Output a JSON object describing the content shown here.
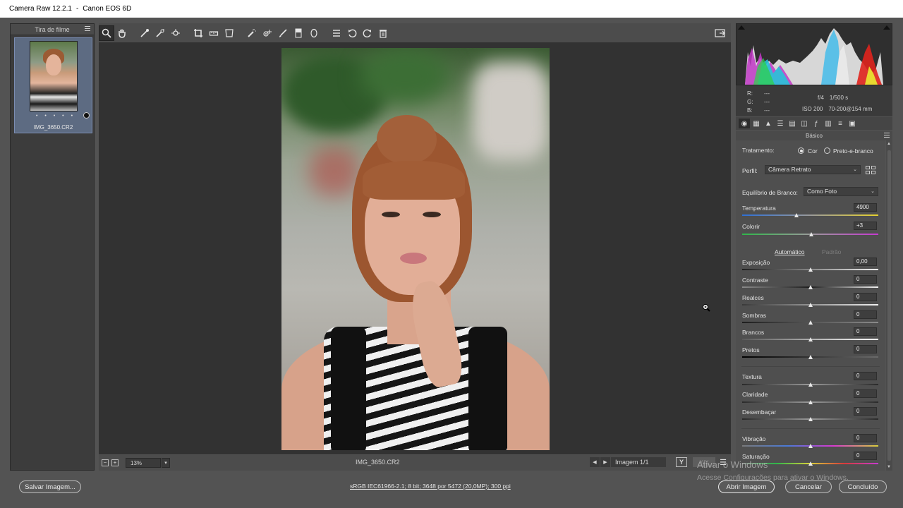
{
  "window": {
    "app_title": "Camera Raw 12.2.1",
    "separator": "-",
    "camera": "Canon EOS 6D"
  },
  "filmstrip": {
    "title": "Tira de filme",
    "items": [
      {
        "filename": "IMG_3650.CR2",
        "rating_dots": "• • • • •"
      }
    ]
  },
  "toolbar": {
    "tools": [
      "zoom-tool-icon",
      "hand-tool-icon",
      "white-balance-tool-icon",
      "color-sampler-tool-icon",
      "targeted-adjustment-tool-icon",
      "crop-tool-icon",
      "straighten-tool-icon",
      "transform-tool-icon",
      "spot-removal-tool-icon",
      "red-eye-removal-tool-icon",
      "adjustment-brush-icon",
      "graduated-filter-icon",
      "radial-filter-icon",
      "preferences-icon",
      "rotate-left-icon",
      "rotate-right-icon",
      "trash-icon"
    ],
    "fullscreen_icon": "toggle-fullscreen-icon"
  },
  "statusbar": {
    "zoom": "13%",
    "filename": "IMG_3650.CR2",
    "image_counter": "Imagem 1/1",
    "y_button": "Y",
    "compare_button": "Y/Y"
  },
  "info": {
    "r_label": "R:",
    "r_value": "---",
    "g_label": "G:",
    "g_value": "---",
    "b_label": "B:",
    "b_value": "---",
    "aperture": "f/4",
    "shutter": "1/500 s",
    "iso": "ISO 200",
    "lens": "70-200@154 mm"
  },
  "panel": {
    "title": "Básico",
    "treatment_label": "Tratamento:",
    "treatment_color": "Cor",
    "treatment_bw": "Preto-e-branco",
    "treatment_selected": "Cor",
    "profile_label": "Perfil:",
    "profile_value": "Câmera Retrato",
    "wb_label": "Equilíbrio de Branco:",
    "wb_value": "Como Foto",
    "auto_label": "Automático",
    "default_label": "Padrão",
    "sliders": {
      "temperature": {
        "label": "Temperatura",
        "value": "4900",
        "position": 0.4
      },
      "tint": {
        "label": "Colorir",
        "value": "+3",
        "position": 0.51
      },
      "exposure": {
        "label": "Exposição",
        "value": "0,00",
        "position": 0.5
      },
      "contrast": {
        "label": "Contraste",
        "value": "0",
        "position": 0.5
      },
      "highlights": {
        "label": "Realces",
        "value": "0",
        "position": 0.5
      },
      "shadows": {
        "label": "Sombras",
        "value": "0",
        "position": 0.5
      },
      "whites": {
        "label": "Brancos",
        "value": "0",
        "position": 0.5
      },
      "blacks": {
        "label": "Pretos",
        "value": "0",
        "position": 0.5
      },
      "texture": {
        "label": "Textura",
        "value": "0",
        "position": 0.5
      },
      "clarity": {
        "label": "Claridade",
        "value": "0",
        "position": 0.5
      },
      "dehaze": {
        "label": "Desembaçar",
        "value": "0",
        "position": 0.5
      },
      "vibrance": {
        "label": "Vibração",
        "value": "0",
        "position": 0.5
      },
      "saturation": {
        "label": "Saturação",
        "value": "0",
        "position": 0.5
      }
    }
  },
  "bottom": {
    "save_button": "Salvar Imagem...",
    "workflow_link": "sRGB IEC61966-2.1; 8 bit; 3648 por 5472 (20,0MP); 300 ppi",
    "open_button": "Abrir Imagem",
    "cancel_button": "Cancelar",
    "done_button": "Concluído"
  },
  "watermark": {
    "line1": "Ativar o Windows",
    "line2": "Acesse Configurações para ativar o Windows."
  },
  "colors": {
    "accent_blue": "#7b8db3",
    "panel_bg": "#4f4f4f",
    "canvas_bg": "#323232"
  }
}
